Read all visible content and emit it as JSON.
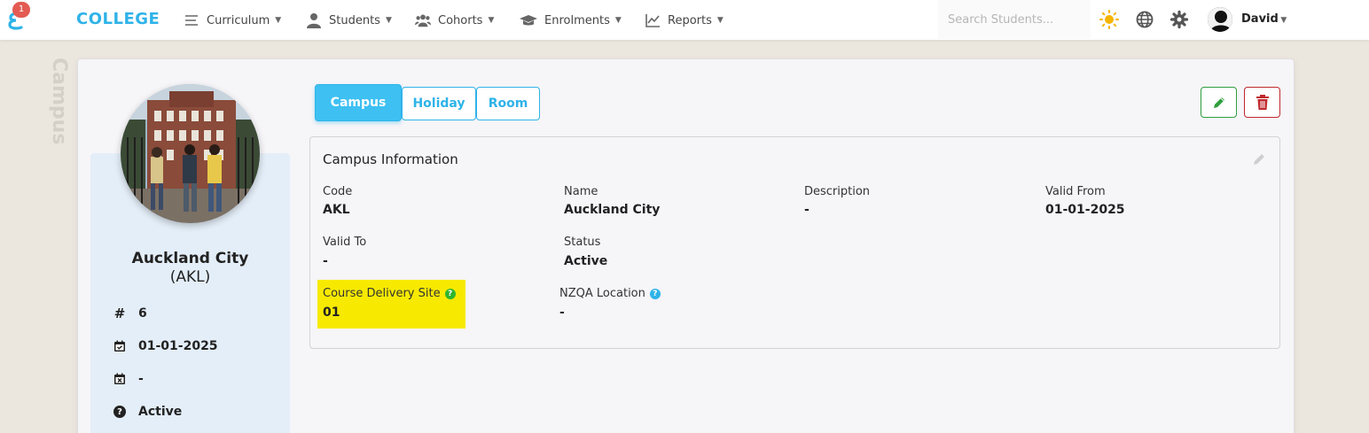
{
  "brand": {
    "name": "COLLEGE",
    "notification_count": "1"
  },
  "nav": {
    "items": [
      {
        "label": "Curriculum",
        "icon": "list-icon"
      },
      {
        "label": "Students",
        "icon": "person-icon"
      },
      {
        "label": "Cohorts",
        "icon": "users-icon"
      },
      {
        "label": "Enrolments",
        "icon": "graduation-cap-icon"
      },
      {
        "label": "Reports",
        "icon": "line-chart-icon"
      }
    ],
    "search_placeholder": "Search Students...",
    "user_name": "David"
  },
  "page": {
    "side_label": "Campus"
  },
  "profile": {
    "name": "Auckland City",
    "code": "(AKL)",
    "number": "6",
    "valid_from": "01-01-2025",
    "valid_to": "-",
    "status": "Active"
  },
  "tabs": [
    {
      "label": "Campus",
      "active": true
    },
    {
      "label": "Holiday",
      "active": false
    },
    {
      "label": "Room",
      "active": false
    }
  ],
  "info": {
    "title": "Campus Information",
    "fields": {
      "code": {
        "label": "Code",
        "value": "AKL"
      },
      "name": {
        "label": "Name",
        "value": "Auckland City"
      },
      "description": {
        "label": "Description",
        "value": "-"
      },
      "valid_from": {
        "label": "Valid From",
        "value": "01-01-2025"
      },
      "valid_to": {
        "label": "Valid To",
        "value": "-"
      },
      "status": {
        "label": "Status",
        "value": "Active"
      },
      "course_delivery_site": {
        "label": "Course Delivery Site",
        "value": "01"
      },
      "nzqa_location": {
        "label": "NZQA Location",
        "value": "-"
      }
    }
  },
  "colors": {
    "accent": "#2eb3e8",
    "highlight": "#f7ea00",
    "edit": "#2e9e3e",
    "delete": "#c0282d"
  }
}
